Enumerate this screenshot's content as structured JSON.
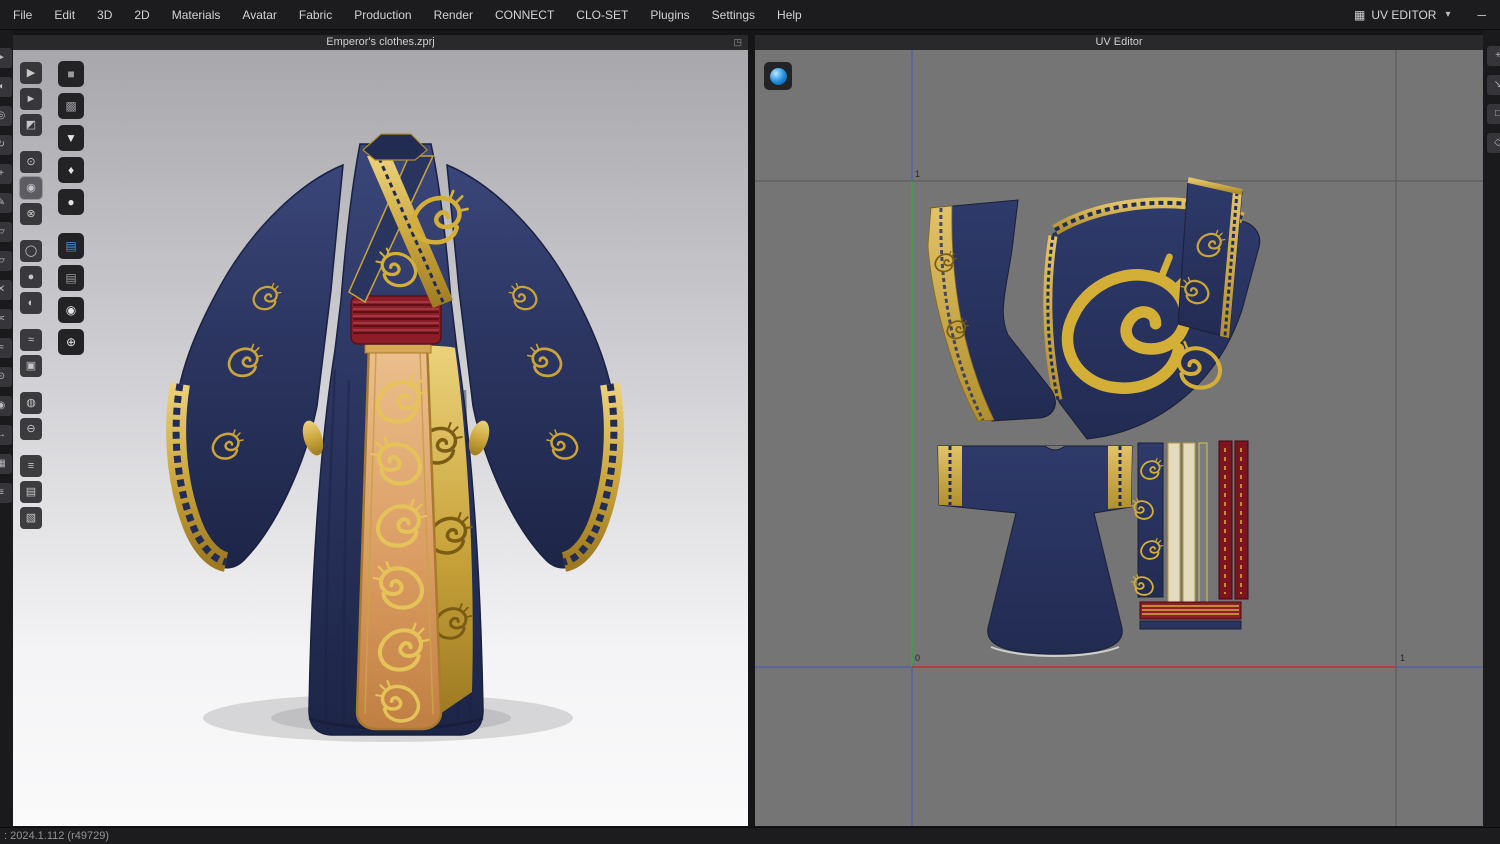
{
  "menu_bar": {
    "items": [
      "File",
      "Edit",
      "3D",
      "2D",
      "Materials",
      "Avatar",
      "Fabric",
      "Production",
      "Render",
      "CONNECT",
      "CLO-SET",
      "Plugins",
      "Settings",
      "Help"
    ],
    "uv_editor_label": "UV EDITOR"
  },
  "viewport3d": {
    "title": "Emperor's clothes.zprj"
  },
  "uv_editor": {
    "title": "UV Editor",
    "labels": {
      "v_max": "1",
      "origin": "0",
      "u_max": "1"
    }
  },
  "status_bar": {
    "version_text": ": 2024.1.112 (r49729)"
  },
  "colors": {
    "robe_navy": "#2b3560",
    "trim_gold": "#c9a43b",
    "sash_red": "#8c1c27",
    "panel_orange": "#dfa469",
    "uv_background": "#757575",
    "axis_green": "#2eaa3a",
    "axis_red": "#c03030",
    "axis_blue": "#4752c4",
    "accent_blue": "#2f8fe0"
  },
  "toolbars": {
    "edge_left": [
      "cursor-icon",
      "hand-icon",
      "zoom-icon",
      "rotate-view-icon",
      "pan-icon",
      "pen-icon",
      "edit-pattern-icon",
      "trace-icon",
      "scissors-icon",
      "sewing-icon",
      "free-sewing-icon",
      "pin-icon",
      "tack-icon",
      "measure-icon",
      "texture-icon",
      "grade-icon"
    ],
    "main_left": {
      "groups": [
        [
          "simulate-icon",
          "select-move-icon",
          "select-mesh-icon"
        ],
        [
          "pin-icon",
          "tack-on-avatar-icon",
          "attach-icon"
        ],
        [
          "ring-icon",
          "sphere-icon",
          "hemisphere-icon"
        ],
        [
          "steam-icon",
          "solidify-icon"
        ],
        [
          "button-icon",
          "buttonhole-icon"
        ],
        [
          "zipper-icon",
          "trim-box-icon",
          "padding-icon"
        ]
      ],
      "active": "tack-on-avatar-icon"
    },
    "show_3d": {
      "groups": [
        [
          "show-garment-cube-icon",
          "show-garment-shaded-icon",
          "show-shirt-icon",
          "show-avatar-figure-icon",
          "show-avatar-bust-icon"
        ],
        [
          "show-fabric-blue-icon",
          "show-fabric-gray-icon",
          "show-head-icon",
          "show-globe-icon"
        ]
      ]
    },
    "edge_right": [
      "gizmo-icon",
      "scale-icon",
      "frame-icon",
      "snap-icon"
    ]
  }
}
